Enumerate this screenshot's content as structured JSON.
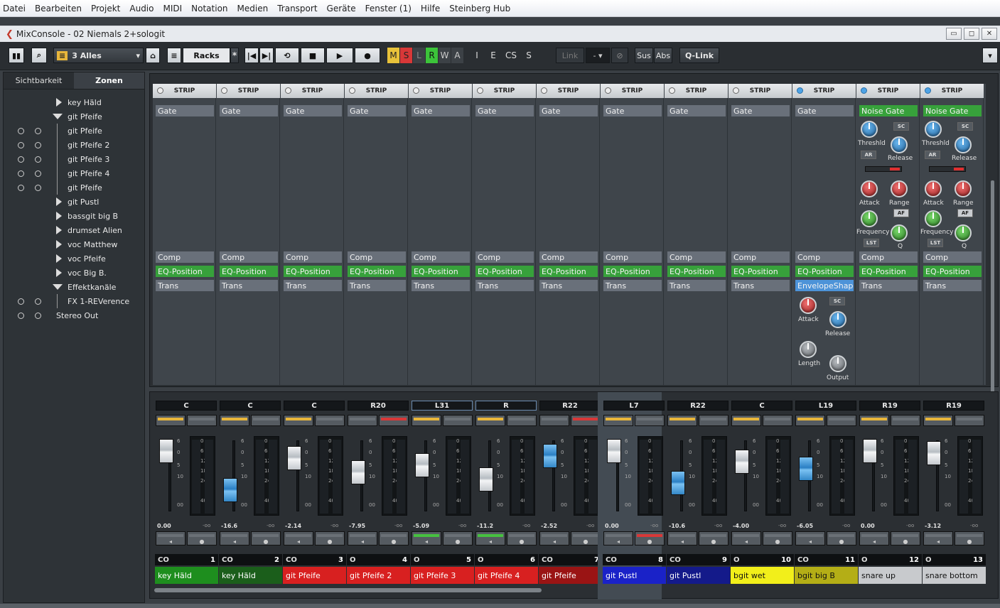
{
  "menu": [
    "Datei",
    "Bearbeiten",
    "Projekt",
    "Audio",
    "MIDI",
    "Notation",
    "Medien",
    "Transport",
    "Geräte",
    "Fenster (1)",
    "Hilfe",
    "Steinberg Hub"
  ],
  "window": {
    "title": "MixConsole - 02 Niemals 2+sologit",
    "min": "▭",
    "max": "◻",
    "close": "✕"
  },
  "toolbar": {
    "config_label": "3 Alles",
    "racks_label": "Racks",
    "star": "*",
    "m": "M",
    "s": "S",
    "l": "L",
    "r": "R",
    "w": "W",
    "a": "A",
    "i": "I",
    "e": "E",
    "cs": "CS",
    "s2": "S",
    "link": "Link",
    "link_sel": "- ▾",
    "sus": "Sus",
    "abs": "Abs",
    "qlink": "Q-Link"
  },
  "colors": {
    "m_active": "#e8c23a",
    "s_active": "#d83838",
    "r_active": "#3cc43a"
  },
  "left": {
    "tabs": [
      "Sichtbarkeit",
      "Zonen"
    ],
    "items": [
      {
        "label": "key Häld",
        "type": "collapsed",
        "circles": false,
        "indent": 90
      },
      {
        "label": "git Pfeife",
        "type": "expanded",
        "circles": false,
        "indent": 90
      },
      {
        "label": "git Pfeife",
        "type": "child",
        "circles": true,
        "indent": 90
      },
      {
        "label": "git Pfeife 2",
        "type": "child",
        "circles": true,
        "indent": 90
      },
      {
        "label": "git Pfeife 3",
        "type": "child",
        "circles": true,
        "indent": 90
      },
      {
        "label": "git Pfeife 4",
        "type": "child",
        "circles": true,
        "indent": 90
      },
      {
        "label": "git Pfeife",
        "type": "child",
        "circles": true,
        "indent": 90
      },
      {
        "label": "git Pustl",
        "type": "collapsed",
        "circles": false,
        "indent": 90
      },
      {
        "label": "bassgit big B",
        "type": "collapsed",
        "circles": false,
        "indent": 90
      },
      {
        "label": "drumset Alien",
        "type": "collapsed",
        "circles": false,
        "indent": 90
      },
      {
        "label": "voc Matthew",
        "type": "collapsed",
        "circles": false,
        "indent": 90
      },
      {
        "label": "voc Pfeife",
        "type": "collapsed",
        "circles": false,
        "indent": 90
      },
      {
        "label": "voc Big B.",
        "type": "collapsed",
        "circles": false,
        "indent": 90
      },
      {
        "label": "Effektkanäle",
        "type": "expanded",
        "circles": false,
        "indent": 90
      },
      {
        "label": "FX 1-REVerence",
        "type": "child",
        "circles": true,
        "indent": 90
      },
      {
        "label": "Stereo Out",
        "type": "plain",
        "circles": true,
        "indent": 74
      }
    ]
  },
  "strip_label": "STRIP",
  "rack_slots": {
    "gate": "Gate",
    "noise_gate": "Noise Gate",
    "comp": "Comp",
    "eq": "EQ-Position",
    "trans": "Trans",
    "envelope": "EnvelopeShap"
  },
  "knob_labels": {
    "threshld": "Threshld",
    "release": "Release",
    "attack": "Attack",
    "range": "Range",
    "frequency": "Frequency",
    "q": "Q",
    "length": "Length",
    "output": "Output",
    "sc": "SC",
    "ar": "AR",
    "af": "AF",
    "lst": "LST"
  },
  "scale": {
    "fader": [
      "6",
      "0",
      "5",
      "10",
      "00"
    ],
    "meter": [
      "0",
      "6",
      "12",
      "18",
      "24",
      "40"
    ]
  },
  "channels": [
    {
      "num": "1",
      "name": "key Häld",
      "color": "#1e8e1e",
      "pan": "C",
      "vol": "0.00",
      "peak": "-oo",
      "stereo": true,
      "fader": 0.85,
      "blue": false,
      "rackblue": false,
      "noise": false,
      "lamp": "y",
      "lamp2": "",
      "solo": "",
      "env": false
    },
    {
      "num": "2",
      "name": "key Häld",
      "color": "#1b5e1b",
      "pan": "C",
      "vol": "-16.6",
      "peak": "-oo",
      "stereo": true,
      "fader": 0.3,
      "blue": true,
      "rackblue": false,
      "noise": false,
      "lamp": "y",
      "lamp2": "",
      "solo": "",
      "env": false
    },
    {
      "num": "3",
      "name": "git Pfeife",
      "color": "#d82020",
      "pan": "C",
      "vol": "-2.14",
      "peak": "-oo",
      "stereo": true,
      "fader": 0.75,
      "blue": false,
      "rackblue": false,
      "noise": false,
      "lamp": "y",
      "lamp2": "",
      "solo": "",
      "env": false
    },
    {
      "num": "4",
      "name": "git Pfeife 2",
      "color": "#d82020",
      "pan": "R20",
      "vol": "-7.95",
      "peak": "-oo",
      "stereo": false,
      "fader": 0.55,
      "blue": false,
      "rackblue": false,
      "noise": false,
      "lamp": "",
      "lamp2": "r",
      "solo": "",
      "env": false
    },
    {
      "num": "5",
      "name": "git Pfeife 3",
      "color": "#d82020",
      "pan": "L31",
      "vol": "-5.09",
      "peak": "-oo",
      "stereo": false,
      "fader": 0.65,
      "blue": false,
      "rackblue": false,
      "noise": false,
      "lamp": "y",
      "lamp2": "",
      "solo": "g",
      "env": false,
      "selpan": true
    },
    {
      "num": "6",
      "name": "git Pfeife 4",
      "color": "#d82020",
      "pan": "R",
      "vol": "-11.2",
      "peak": "-oo",
      "stereo": false,
      "fader": 0.45,
      "blue": false,
      "rackblue": false,
      "noise": false,
      "lamp": "y",
      "lamp2": "",
      "solo": "g",
      "env": false,
      "selpan": true
    },
    {
      "num": "7",
      "name": "git Pfeife",
      "color": "#9a1414",
      "pan": "R22",
      "vol": "-2.52",
      "peak": "-oo",
      "stereo": true,
      "fader": 0.78,
      "blue": true,
      "rackblue": false,
      "noise": false,
      "lamp": "",
      "lamp2": "r",
      "solo": "",
      "env": false
    },
    {
      "num": "8",
      "name": "git Pustl",
      "color": "#1a22c8",
      "pan": "L7",
      "vol": "0.00",
      "peak": "-oo",
      "stereo": true,
      "fader": 0.85,
      "blue": false,
      "rackblue": false,
      "noise": false,
      "lamp": "y",
      "lamp2": "",
      "solo": "r",
      "env": false,
      "sel": true
    },
    {
      "num": "9",
      "name": "git Pustl",
      "color": "#141a8a",
      "pan": "R22",
      "vol": "-10.6",
      "peak": "-oo",
      "stereo": true,
      "fader": 0.4,
      "blue": true,
      "rackblue": false,
      "noise": false,
      "lamp": "y",
      "lamp2": "",
      "solo": "",
      "env": false
    },
    {
      "num": "10",
      "name": "bgit wet",
      "color": "#f2ef1a",
      "pan": "C",
      "vol": "-4.00",
      "peak": "-oo",
      "stereo": false,
      "fader": 0.7,
      "blue": false,
      "rackblue": false,
      "noise": false,
      "lamp": "y",
      "lamp2": "",
      "solo": "",
      "env": false,
      "darktext": true
    },
    {
      "num": "11",
      "name": "bgit big B",
      "color": "#b4ae16",
      "pan": "L19",
      "vol": "-6.05",
      "peak": "-oo",
      "stereo": true,
      "fader": 0.6,
      "blue": true,
      "rackblue": true,
      "noise": false,
      "lamp": "y",
      "lamp2": "",
      "solo": "",
      "env": true,
      "darktext": true
    },
    {
      "num": "12",
      "name": "snare up",
      "color": "#c8cacd",
      "pan": "R19",
      "vol": "0.00",
      "peak": "-oo",
      "stereo": false,
      "fader": 0.85,
      "blue": false,
      "rackblue": true,
      "noise": true,
      "lamp": "y",
      "lamp2": "",
      "solo": "",
      "env": false,
      "darktext": true
    },
    {
      "num": "13",
      "name": "snare bottom",
      "color": "#c8cacd",
      "pan": "R19",
      "vol": "-3.12",
      "peak": "-oo",
      "stereo": false,
      "fader": 0.82,
      "blue": false,
      "rackblue": true,
      "noise": true,
      "lamp": "y",
      "lamp2": "",
      "solo": "",
      "env": false,
      "darktext": true
    }
  ]
}
